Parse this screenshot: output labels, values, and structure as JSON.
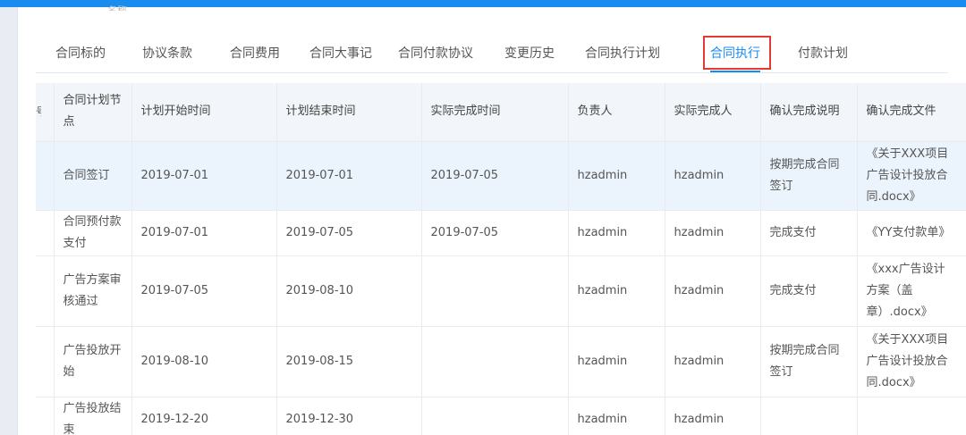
{
  "section_heading_fragment": "名称",
  "tabs": [
    {
      "label": "合同标的",
      "active": false
    },
    {
      "label": "协议条款",
      "active": false
    },
    {
      "label": "合同费用",
      "active": false
    },
    {
      "label": "合同大事记",
      "active": false
    },
    {
      "label": "合同付款协议",
      "active": false
    },
    {
      "label": "变更历史",
      "active": false
    },
    {
      "label": "合同执行计划",
      "active": false
    },
    {
      "label": "合同执行",
      "active": true
    },
    {
      "label": "付款计划",
      "active": false
    }
  ],
  "table": {
    "stub_header": "号",
    "columns": [
      "合同计划节点",
      "计划开始时间",
      "计划结束时间",
      "实际完成时间",
      "负责人",
      "实际完成人",
      "确认完成说明",
      "确认完成文件"
    ],
    "rows": [
      [
        "合同签订",
        "2019-07-01",
        "2019-07-01",
        "2019-07-05",
        "hzadmin",
        "hzadmin",
        "按期完成合同签订",
        "《关于XXX项目广告设计投放合同.docx》"
      ],
      [
        "合同预付款支付",
        "2019-07-01",
        "2019-07-05",
        "2019-07-05",
        "hzadmin",
        "hzadmin",
        "完成支付",
        "《YY支付款单》"
      ],
      [
        "广告方案审核通过",
        "2019-07-05",
        "2019-08-10",
        "",
        "hzadmin",
        "hzadmin",
        "完成支付",
        "《xxx广告设计方案（盖章）.docx》"
      ],
      [
        "广告投放开始",
        "2019-08-10",
        "2019-08-15",
        "",
        "hzadmin",
        "hzadmin",
        "按期完成合同签订",
        "《关于XXX项目广告设计投放合同.docx》"
      ],
      [
        "广告投放结束",
        "2019-12-20",
        "2019-12-30",
        "",
        "hzadmin",
        "hzadmin",
        "",
        ""
      ]
    ]
  },
  "colors": {
    "accent": "#1a8cf0",
    "highlight_box": "#e53935",
    "selected_row": "#ebf4fd",
    "header_bg": "#f2f5f9"
  }
}
